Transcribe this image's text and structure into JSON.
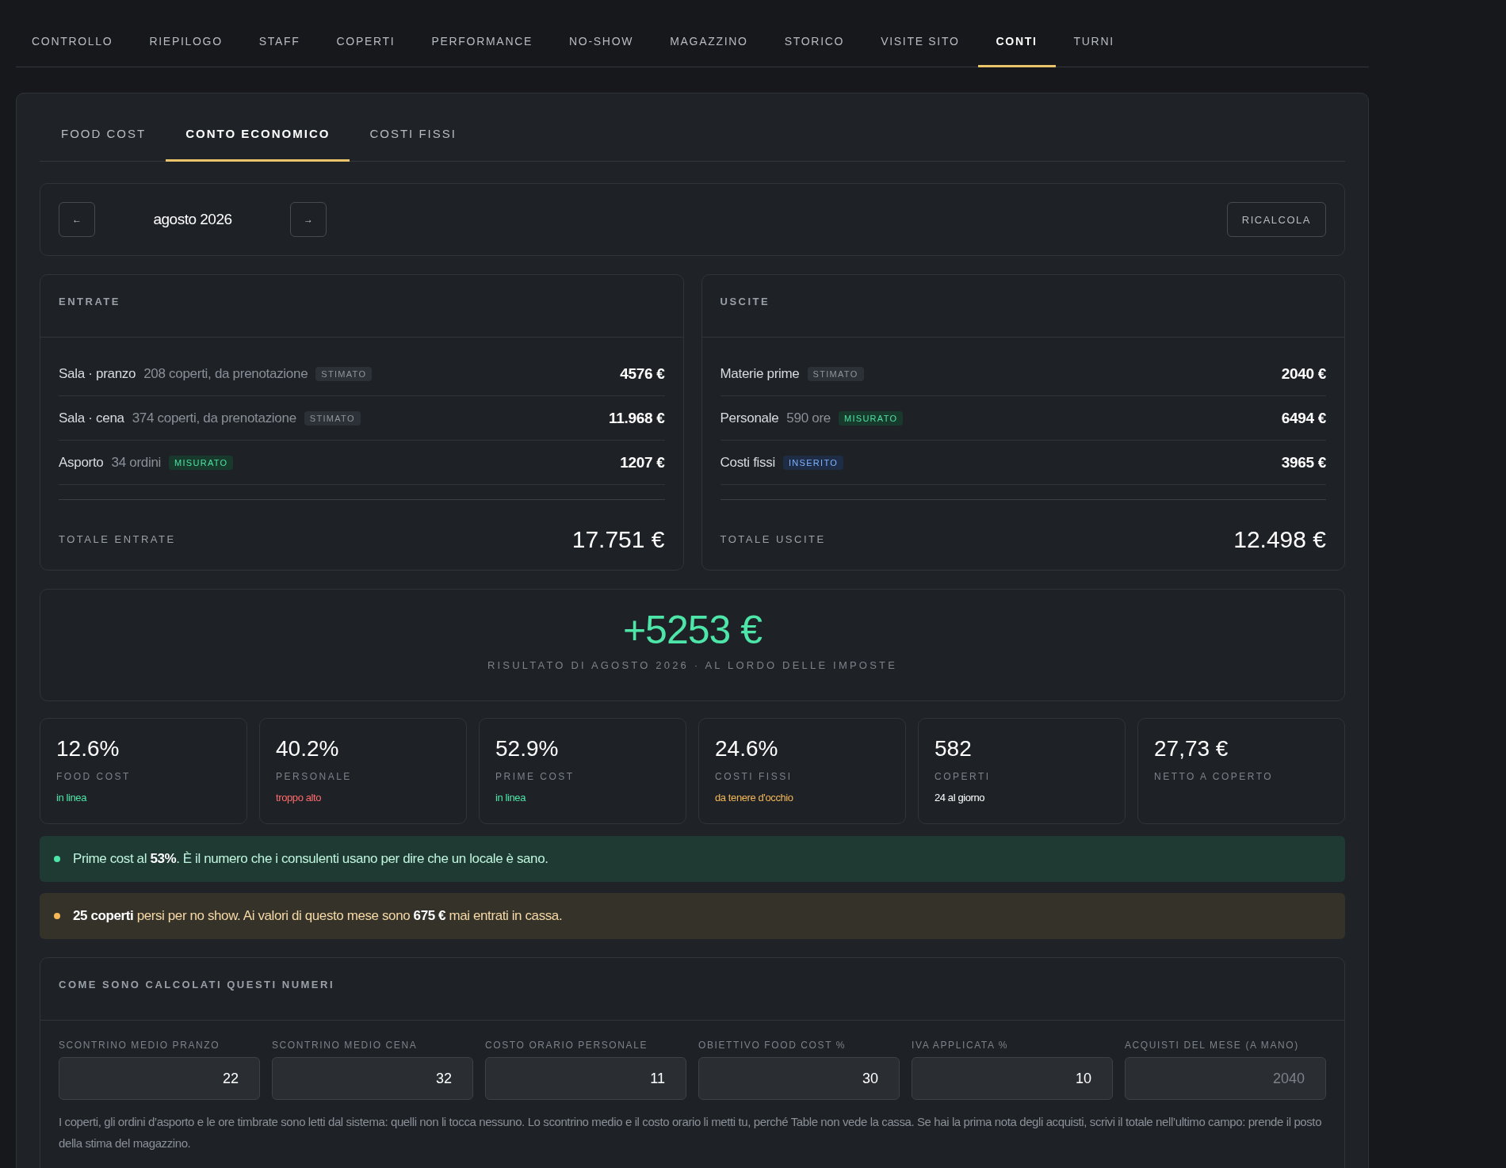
{
  "nav": [
    {
      "label": "CONTROLLO",
      "selected": false
    },
    {
      "label": "RIEPILOGO",
      "selected": false
    },
    {
      "label": "STAFF",
      "selected": false
    },
    {
      "label": "COPERTI",
      "selected": false
    },
    {
      "label": "PERFORMANCE",
      "selected": false
    },
    {
      "label": "NO-SHOW",
      "selected": false
    },
    {
      "label": "MAGAZZINO",
      "selected": false
    },
    {
      "label": "STORICO",
      "selected": false
    },
    {
      "label": "VISITE SITO",
      "selected": false
    },
    {
      "label": "CONTI",
      "selected": true
    },
    {
      "label": "TURNI",
      "selected": false
    }
  ],
  "subtabs": [
    {
      "label": "FOOD COST",
      "selected": false
    },
    {
      "label": "CONTO ECONOMICO",
      "selected": true
    },
    {
      "label": "COSTI FISSI",
      "selected": false
    }
  ],
  "period": {
    "prev": "←",
    "label": "agosto 2026",
    "next": "→",
    "action": "RICALCOLA"
  },
  "columns": [
    {
      "title": "ENTRATE",
      "rows": [
        {
          "name": "Sala · pranzo",
          "detail": "208 coperti, da prenotazione",
          "badge": {
            "text": "STIMATO",
            "kind": "estimated"
          },
          "amount": "4576 €"
        },
        {
          "name": "Sala · cena",
          "detail": "374 coperti, da prenotazione",
          "badge": {
            "text": "STIMATO",
            "kind": "estimated"
          },
          "amount": "11.968 €"
        },
        {
          "name": "Asporto",
          "detail": "34 ordini",
          "badge": {
            "text": "MISURATO",
            "kind": "measured"
          },
          "amount": "1207 €"
        }
      ],
      "total_label": "TOTALE ENTRATE",
      "total": "17.751 €"
    },
    {
      "title": "USCITE",
      "rows": [
        {
          "name": "Materie prime",
          "badge": {
            "text": "STIMATO",
            "kind": "estimated"
          },
          "amount": "2040 €"
        },
        {
          "name": "Personale",
          "detail": "590 ore",
          "badge": {
            "text": "MISURATO",
            "kind": "measured"
          },
          "amount": "6494 €"
        },
        {
          "name": "Costi fissi",
          "badge": {
            "text": "INSERITO",
            "kind": "entered"
          },
          "amount": "3965 €"
        }
      ],
      "total_label": "TOTALE USCITE",
      "total": "12.498 €"
    }
  ],
  "result": {
    "value": "+5253 €",
    "caption": "RISULTATO DI AGOSTO 2026 · AL LORDO DELLE IMPOSTE"
  },
  "kpis": [
    {
      "value": "12.6%",
      "label": "FOOD COST",
      "status": {
        "text": "in linea",
        "kind": "good"
      }
    },
    {
      "value": "40.2%",
      "label": "PERSONALE",
      "status": {
        "text": "troppo alto",
        "kind": "bad"
      }
    },
    {
      "value": "52.9%",
      "label": "PRIME COST",
      "status": {
        "text": "in linea",
        "kind": "good"
      }
    },
    {
      "value": "24.6%",
      "label": "COSTI FISSI",
      "status": {
        "text": "da tenere d'occhio",
        "kind": "warn"
      }
    },
    {
      "value": "582",
      "label": "COPERTI",
      "status": {
        "text": "24 al giorno",
        "kind": "neutral"
      }
    },
    {
      "value": "27,73 €",
      "label": "NETTO A COPERTO"
    }
  ],
  "alerts": [
    {
      "kind": "success",
      "text": "Prime cost al **53%**. È il numero che i consulenti usano per dire che un locale è sano."
    },
    {
      "kind": "warning",
      "text": "**25 coperti** persi per no show. Ai valori di questo mese sono **675 €** mai entrati in cassa."
    }
  ],
  "settings": {
    "title": "COME SONO CALCOLATI QUESTI NUMERI",
    "fields": [
      {
        "label": "SCONTRINO MEDIO PRANZO",
        "value": "22"
      },
      {
        "label": "SCONTRINO MEDIO CENA",
        "value": "32"
      },
      {
        "label": "COSTO ORARIO PERSONALE",
        "value": "11"
      },
      {
        "label": "OBIETTIVO FOOD COST %",
        "value": "30"
      },
      {
        "label": "IVA APPLICATA %",
        "value": "10"
      },
      {
        "label": "ACQUISTI DEL MESE (A MANO)",
        "placeholder": "2040"
      }
    ],
    "note": "I coperti, gli ordini d’asporto e le ore timbrate sono letti dal sistema: quelli non li tocca nessuno. Lo scontrino medio e il costo orario li metti tu, perché Table non vede la cassa. Se hai la prima nota degli acquisti, scrivi il totale nell’ultimo campo: prende il posto della stima del magazzino."
  }
}
